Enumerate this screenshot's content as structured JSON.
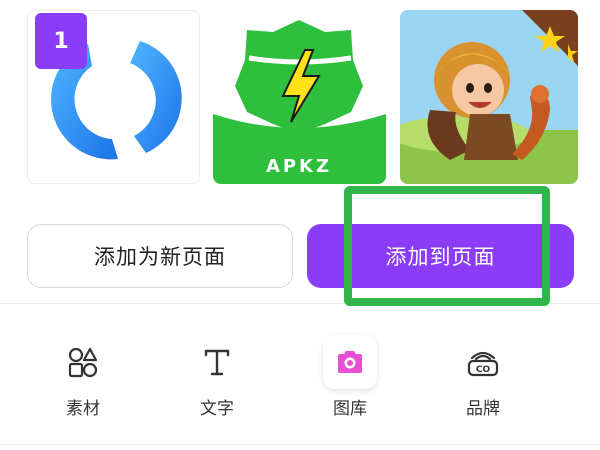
{
  "thumbnails": {
    "first_badge": "1",
    "apkz_text": "APKZ"
  },
  "actions": {
    "add_new_page": "添加为新页面",
    "add_to_page": "添加到页面"
  },
  "tabbar": {
    "items": [
      {
        "label": "素材",
        "icon": "shapes-icon"
      },
      {
        "label": "文字",
        "icon": "text-icon"
      },
      {
        "label": "图库",
        "icon": "camera-icon",
        "selected": true
      },
      {
        "label": "品牌",
        "icon": "brand-icon"
      }
    ]
  },
  "colors": {
    "accent": "#8b3cf6",
    "highlight": "#31b44a",
    "camera_icon": "#e84fd3"
  }
}
